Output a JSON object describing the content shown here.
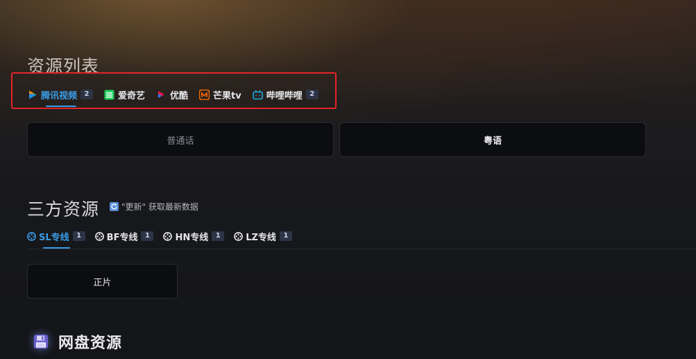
{
  "resources": {
    "title": "资源列表",
    "platforms": [
      {
        "label": "腾讯视频",
        "count": "2",
        "icon": "tencent-video-icon",
        "active": true
      },
      {
        "label": "爱奇艺",
        "count": "",
        "icon": "iqiyi-icon",
        "active": false
      },
      {
        "label": "优酷",
        "count": "",
        "icon": "youku-icon",
        "active": false
      },
      {
        "label": "芒果tv",
        "count": "",
        "icon": "mango-tv-icon",
        "active": false
      },
      {
        "label": "哔哩哔哩",
        "count": "2",
        "icon": "bilibili-icon",
        "active": false
      }
    ],
    "audio_options": [
      {
        "label": "普通话",
        "selected": false
      },
      {
        "label": "粤语",
        "selected": true
      }
    ]
  },
  "third_party": {
    "title": "三方资源",
    "refresh_hint": "\"更新\" 获取最新数据",
    "lines": [
      {
        "label": "SL专线",
        "count": "1",
        "active": true
      },
      {
        "label": "BF专线",
        "count": "1",
        "active": false
      },
      {
        "label": "HN专线",
        "count": "1",
        "active": false
      },
      {
        "label": "LZ专线",
        "count": "1",
        "active": false
      }
    ],
    "episodes": [
      {
        "label": "正片"
      }
    ]
  },
  "netdisk": {
    "title": "网盘资源",
    "icon": "floppy-disk-icon"
  },
  "colors": {
    "accent": "#3a9ce8",
    "highlight_box": "#e5242a",
    "button_bg": "#0c0d10"
  }
}
